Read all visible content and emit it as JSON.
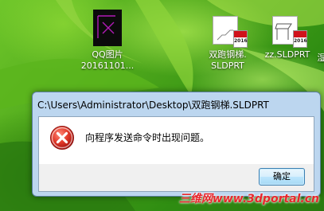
{
  "desktop": {
    "icons": [
      {
        "label_line1": "QQ图片",
        "label_line2": "20161101..."
      },
      {
        "label_line1": "双跑钢梯.",
        "label_line2": "SLDPRT",
        "badge_year": "2016"
      },
      {
        "label_line1": "zz.SLDPRT",
        "label_line2": "",
        "badge_year": "2016"
      }
    ],
    "partial_icon_label": "湿"
  },
  "dialog": {
    "title": "C:\\Users\\Administrator\\Desktop\\双跑钢梯.SLDPRT",
    "message": "向程序发送命令时出现问题。",
    "ok_label": "确定"
  },
  "watermark": "三维网www.3dportal.cn",
  "colors": {
    "error_red": "#d62a2a",
    "titlebar": "#bcd6ef",
    "button_border": "#3c7fb1"
  }
}
